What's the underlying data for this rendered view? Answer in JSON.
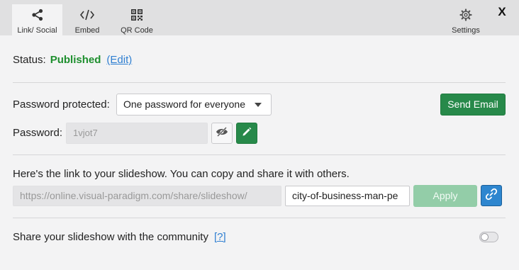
{
  "tabs": [
    {
      "label": "Link/ Social",
      "icon": "share-icon",
      "active": true
    },
    {
      "label": "Embed",
      "icon": "code-icon",
      "active": false
    },
    {
      "label": "QR Code",
      "icon": "qr-code-icon",
      "active": false
    }
  ],
  "settings": {
    "label": "Settings",
    "icon": "gear-icon"
  },
  "close": {
    "label": "X"
  },
  "status": {
    "label": "Status:",
    "value": "Published",
    "edit_label": "(Edit)",
    "value_color": "#1e8f2e"
  },
  "password_protected": {
    "label": "Password protected:",
    "selected": "One password for everyone"
  },
  "send_email": {
    "label": "Send Email"
  },
  "password": {
    "label": "Password:",
    "value": "1vjot7"
  },
  "share_link": {
    "description": "Here's the link to your slideshow. You can copy and share it with others.",
    "base_url": "https://online.visual-paradigm.com/share/slideshow/",
    "slug": "city-of-business-man-pe",
    "apply_label": "Apply"
  },
  "community": {
    "label": "Share your slideshow with the community",
    "help_label": "[?]",
    "enabled": false
  },
  "colors": {
    "accent_green": "#27894a",
    "link_blue": "#2f7fd1",
    "copy_blue": "#2e86cf"
  }
}
